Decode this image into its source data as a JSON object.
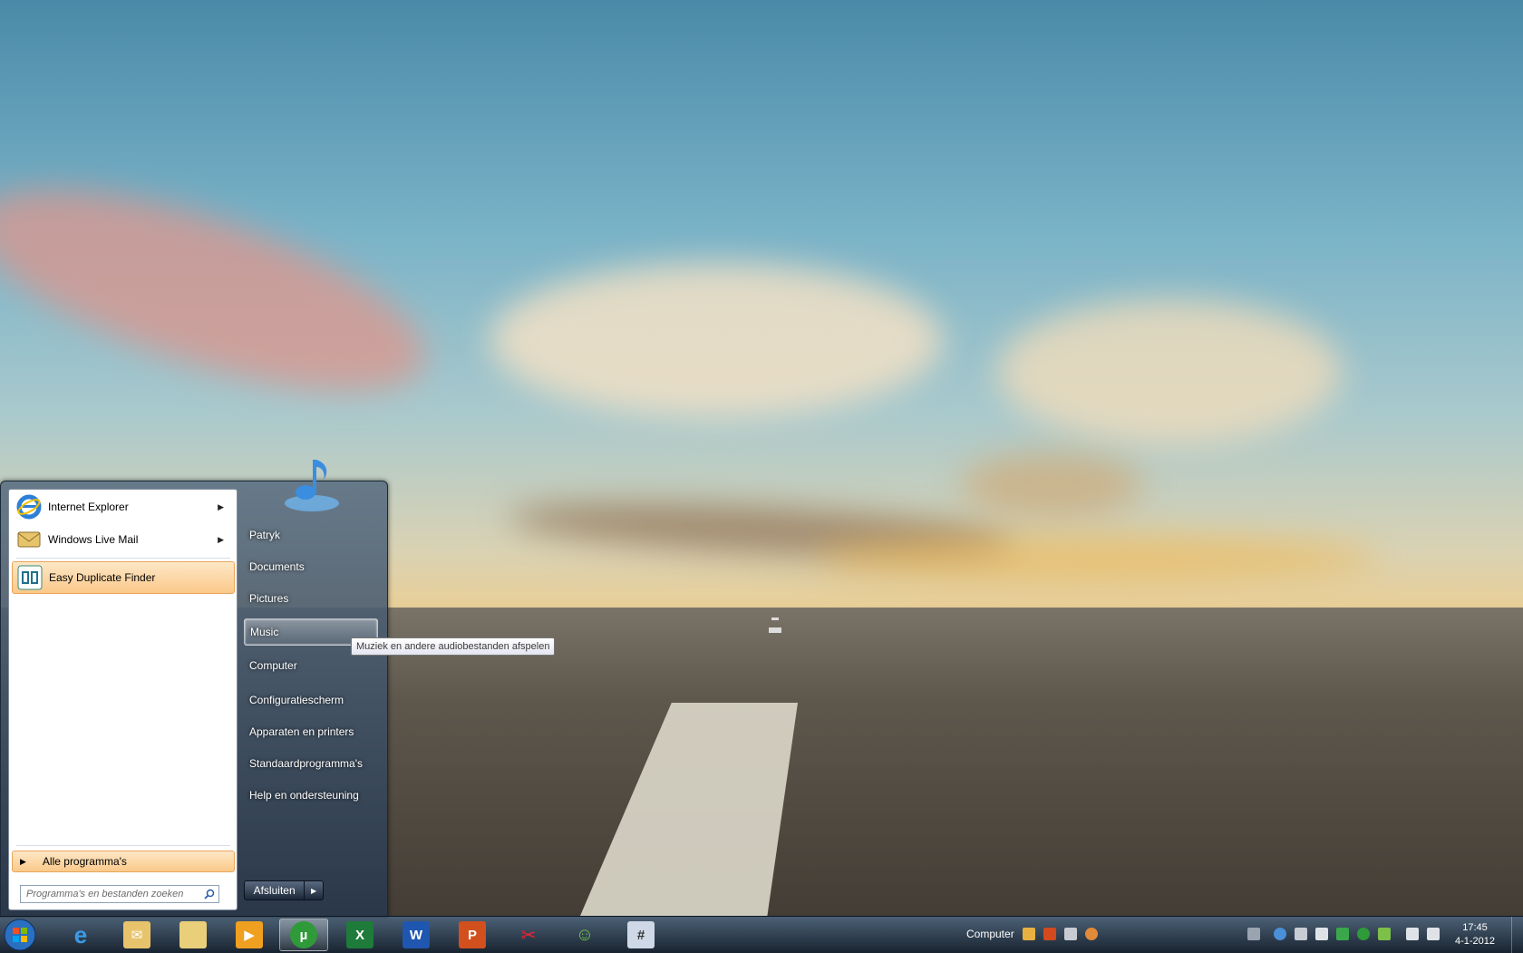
{
  "start_menu": {
    "pinned": [
      {
        "label": "Internet Explorer",
        "icon": "internet-explorer-icon",
        "has_submenu": true
      },
      {
        "label": "Windows Live Mail",
        "icon": "windows-live-mail-icon",
        "has_submenu": true
      }
    ],
    "recent": [
      {
        "label": "Easy Duplicate Finder",
        "icon": "easy-duplicate-finder-icon"
      }
    ],
    "all_programs_label": "Alle programma's",
    "search_placeholder": "Programma's en bestanden zoeken",
    "right_items": [
      {
        "label": "Patryk"
      },
      {
        "label": "Documents"
      },
      {
        "label": "Pictures"
      },
      {
        "label": "Music"
      },
      {
        "label": "Computer"
      },
      {
        "label": "Configuratiescherm"
      },
      {
        "label": "Apparaten en printers"
      },
      {
        "label": "Standaardprogramma's"
      },
      {
        "label": "Help en ondersteuning"
      }
    ],
    "shutdown_label": "Afsluiten",
    "tooltip": "Muziek en andere audiobestanden afspelen"
  },
  "taskbar": {
    "pinned_icons": [
      "internet-explorer-icon",
      "windows-live-mail-icon",
      "explorer-folder-icon",
      "media-player-icon",
      "utorrent-icon",
      "excel-icon",
      "word-icon",
      "powerpoint-icon",
      "snipping-tool-icon",
      "windows-live-messenger-icon",
      "calculator-icon"
    ],
    "active_icon": "utorrent-icon",
    "toolbar_label": "Computer",
    "clock_time": "17:45",
    "clock_date": "4-1-2012"
  },
  "colors": {
    "highlight": "#fbc98a",
    "taskbar": "#1c2838"
  }
}
